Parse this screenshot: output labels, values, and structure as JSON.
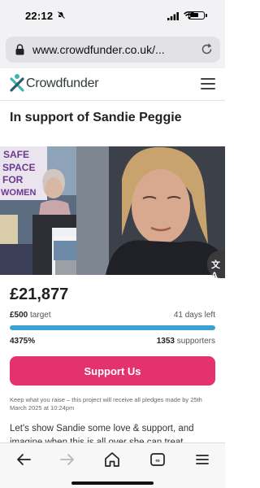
{
  "status_bar": {
    "time": "22:12"
  },
  "browser": {
    "url": "www.crowdfunder.co.uk/..."
  },
  "header": {
    "logo_text": "Crowdfunder"
  },
  "page": {
    "title": "In support of Sandie Peggie"
  },
  "hero": {
    "sign_lines": [
      "SAFE",
      "SPACE",
      "FOR",
      "WOMEN"
    ]
  },
  "campaign": {
    "amount": "£21,877",
    "target_amount": "£500",
    "target_label": "target",
    "days_left": "41 days left",
    "percent": "4375%",
    "progress_fraction": 1.0,
    "supporters_count": "1353",
    "supporters_label": "supporters",
    "support_button": "Support Us",
    "note": "Keep what you raise – this project will receive all pledges made by 25th March 2025 at 10:24pm",
    "description": "Let's show Sandie some love & support, and imagine when this is all over she can treat"
  },
  "translate": {
    "label": "文A"
  },
  "colors": {
    "accent": "#e4326e",
    "progress": "#3aa2d5",
    "logo_teal": "#3fb6b0"
  }
}
